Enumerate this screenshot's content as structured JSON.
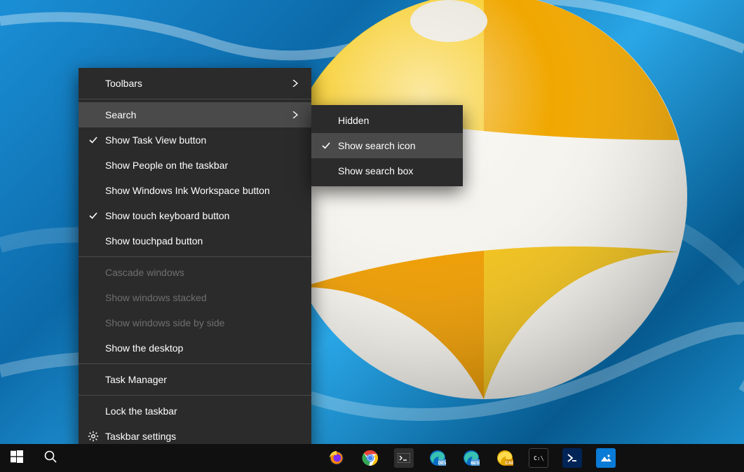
{
  "main_menu": {
    "toolbars": "Toolbars",
    "search": "Search",
    "show_task_view": "Show Task View button",
    "show_people": "Show People on the taskbar",
    "show_ink": "Show Windows Ink Workspace button",
    "show_touch_keyboard": "Show touch keyboard button",
    "show_touchpad": "Show touchpad button",
    "cascade": "Cascade windows",
    "stacked": "Show windows stacked",
    "sidebyside": "Show windows side by side",
    "show_desktop": "Show the desktop",
    "task_manager": "Task Manager",
    "lock_taskbar": "Lock the taskbar",
    "taskbar_settings": "Taskbar settings"
  },
  "sub_menu": {
    "hidden": "Hidden",
    "show_icon": "Show search icon",
    "show_box": "Show search box"
  },
  "taskbar": {
    "start": "Start",
    "search": "Search",
    "apps": [
      {
        "name": "firefox",
        "bg": "#1d1d1d"
      },
      {
        "name": "chrome",
        "bg": "#1d1d1d"
      },
      {
        "name": "terminal",
        "bg": "#2e2e2e"
      },
      {
        "name": "edge-dev",
        "bg": "#1d1d1d"
      },
      {
        "name": "edge-beta",
        "bg": "#1d1d1d"
      },
      {
        "name": "edge-canary",
        "bg": "#1d1d1d"
      },
      {
        "name": "cmd",
        "bg": "#0c0c0c"
      },
      {
        "name": "powershell",
        "bg": "#012456"
      },
      {
        "name": "photos",
        "bg": "#0a7bd6"
      }
    ]
  },
  "colors": {
    "menu_bg": "#2b2b2b",
    "menu_hover": "#4a4a4a",
    "menu_disabled": "#6f6f6f",
    "taskbar_bg": "#101010"
  }
}
